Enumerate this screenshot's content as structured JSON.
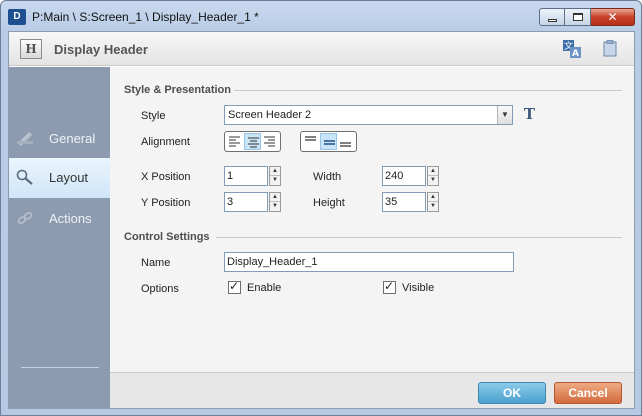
{
  "window": {
    "title": "P:Main \\ S:Screen_1 \\ Display_Header_1 *",
    "app_icon_text": "D"
  },
  "header": {
    "icon_letter": "H",
    "title": "Display Header"
  },
  "sidebar": {
    "items": [
      {
        "label": "General",
        "icon": "pencil-ruler-icon",
        "active": false
      },
      {
        "label": "Layout",
        "icon": "magnifier-icon",
        "active": true
      },
      {
        "label": "Actions",
        "icon": "chain-link-icon",
        "active": false
      }
    ]
  },
  "style_section": {
    "title": "Style & Presentation",
    "style_label": "Style",
    "style_value": "Screen Header 2",
    "font_button": "T",
    "alignment_label": "Alignment",
    "horizontal_alignment_selected": "center",
    "vertical_alignment_selected": "middle",
    "x_label": "X Position",
    "x_value": "1",
    "y_label": "Y Position",
    "y_value": "3",
    "width_label": "Width",
    "width_value": "240",
    "height_label": "Height",
    "height_value": "35"
  },
  "control_section": {
    "title": "Control Settings",
    "name_label": "Name",
    "name_value": "Display_Header_1",
    "options_label": "Options",
    "enable_label": "Enable",
    "enable_checked": true,
    "visible_label": "Visible",
    "visible_checked": true
  },
  "footer": {
    "ok_label": "OK",
    "cancel_label": "Cancel"
  },
  "colors": {
    "ok_button": "#4aa1cf",
    "cancel_button": "#d46a3d",
    "sidebar": "#8c9bb0",
    "active_nav": "#cfe6f8"
  }
}
